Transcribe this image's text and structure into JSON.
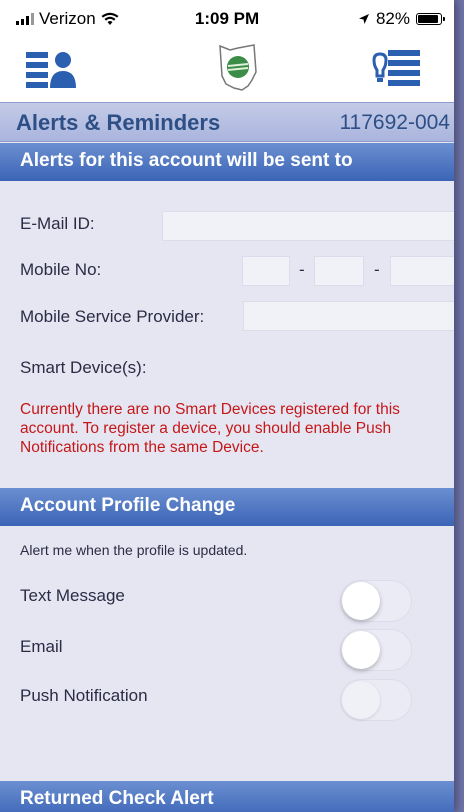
{
  "status_bar": {
    "carrier": "Verizon",
    "time": "1:09 PM",
    "battery_percent": "82%",
    "battery_level": 0.82,
    "icons": [
      "signal-icon",
      "wifi-icon",
      "location-arrow-icon",
      "battery-icon"
    ]
  },
  "nav": {
    "left_icon": "profile-menu-icon",
    "center_icon": "ohio-logo-icon",
    "right_icon": "bill-list-icon"
  },
  "header": {
    "title": "Alerts & Reminders",
    "account_number": "117692-004"
  },
  "alerts_section": {
    "title": "Alerts for this account will be sent to",
    "email_label": "E-Mail ID:",
    "email_value": "",
    "mobile_label": "Mobile No:",
    "mobile_parts": [
      "",
      "",
      ""
    ],
    "dash": "-",
    "provider_label": "Mobile Service Provider:",
    "provider_value": "",
    "smart_devices_label": "Smart Device(s):",
    "no_devices_message": "Currently there are no Smart Devices registered for this account. To register a device, you should enable Push Notifications from the same Device."
  },
  "profile_change_section": {
    "title": "Account Profile Change",
    "hint": "Alert me when the profile is updated.",
    "options": [
      {
        "label": "Text Message",
        "enabled": false
      },
      {
        "label": "Email",
        "enabled": false
      },
      {
        "label": "Push Notification",
        "enabled": false,
        "disabled": true
      }
    ]
  },
  "returned_check_section": {
    "title": "Returned Check Alert"
  },
  "colors": {
    "section_header": "#4a72c0",
    "title_text": "#2d4f86",
    "warning_text": "#c41818",
    "background": "#e6e6f3",
    "outer_background": "#6f74aa"
  }
}
